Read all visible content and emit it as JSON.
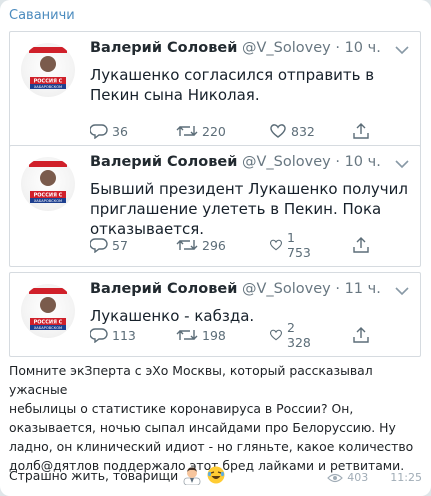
{
  "channel": {
    "name": "Саваничи"
  },
  "tweets": [
    {
      "author": "Валерий Соловей",
      "handle": "@V_Solovey",
      "separator": "·",
      "time": "10 ч.",
      "text": "Лукашенко согласился отправить в Пекин сына Николая.",
      "replies": "36",
      "retweets": "220",
      "likes": "832",
      "avatar_label": "РОССИЯ С ХАБАРОВСКОМ"
    },
    {
      "author": "Валерий Соловей",
      "handle": "@V_Solovey",
      "separator": "·",
      "time": "10 ч.",
      "text": "Бывший президент Лукашенко получил приглашение улететь в Пекин. Пока отказывается.",
      "replies": "57",
      "retweets": "296",
      "likes": "1 753",
      "avatar_label": "РОССИЯ С ХАБАРОВСКОМ"
    },
    {
      "author": "Валерий Соловей",
      "handle": "@V_Solovey",
      "separator": "·",
      "time": "11 ч.",
      "text": "Лукашенко - кабзда.",
      "replies": "113",
      "retweets": "198",
      "likes": "2 328",
      "avatar_label": "РОССИЯ С ХАБАРОВСКОМ"
    }
  ],
  "post": {
    "text": "Помните экЗперта с эХо Москвы, который рассказывал ужасные\nнебылицы о статистике коронавируса в России? Он,\nоказывается, ночью сыпал инсайдами про Белоруссию. Ну\nладно, он клинический идиот - но гляньте, какое количество\nдолб@дятлов поддержало этот бред лайками и ретвитами.",
    "closing": "Страшно жить, товарищи",
    "views": "403",
    "time": "11:25"
  },
  "icons": {
    "reply": "reply-icon",
    "retweet": "retweet-icon",
    "like": "heart-icon",
    "share": "share-icon",
    "more": "chevron-down-icon",
    "views": "eye-icon"
  },
  "colors": {
    "channel_name": "#4b8bbe",
    "avatar_flag_red": "#d0202a",
    "avatar_flag_blue": "#1d3f8f",
    "action_gray": "#5c6d78"
  }
}
